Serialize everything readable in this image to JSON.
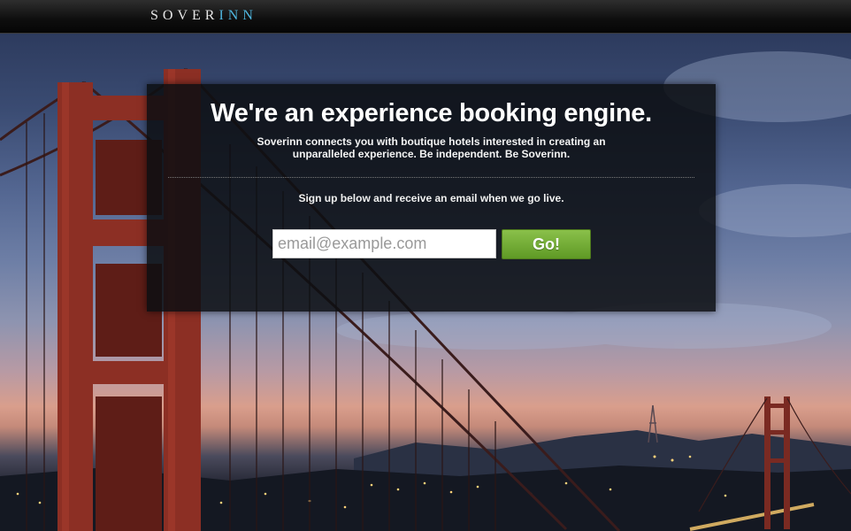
{
  "brand": {
    "logo_part_1": "SOVER",
    "logo_part_2": "INN",
    "colors": {
      "logo_text": "#e6e6e6",
      "logo_accent": "#4fb6df"
    }
  },
  "hero": {
    "headline": "We're an experience booking engine.",
    "subtext": "Soverinn connects you with boutique hotels interested in creating an unparalleled experience. Be independent. Be Soverinn.",
    "signup_prompt": "Sign up below and receive an email when we go live."
  },
  "signup_form": {
    "email_placeholder": "email@example.com",
    "email_value": "",
    "submit_label": "Go!",
    "colors": {
      "button": "#6faa30"
    }
  },
  "background": {
    "icon": "golden-gate-bridge-photo"
  }
}
